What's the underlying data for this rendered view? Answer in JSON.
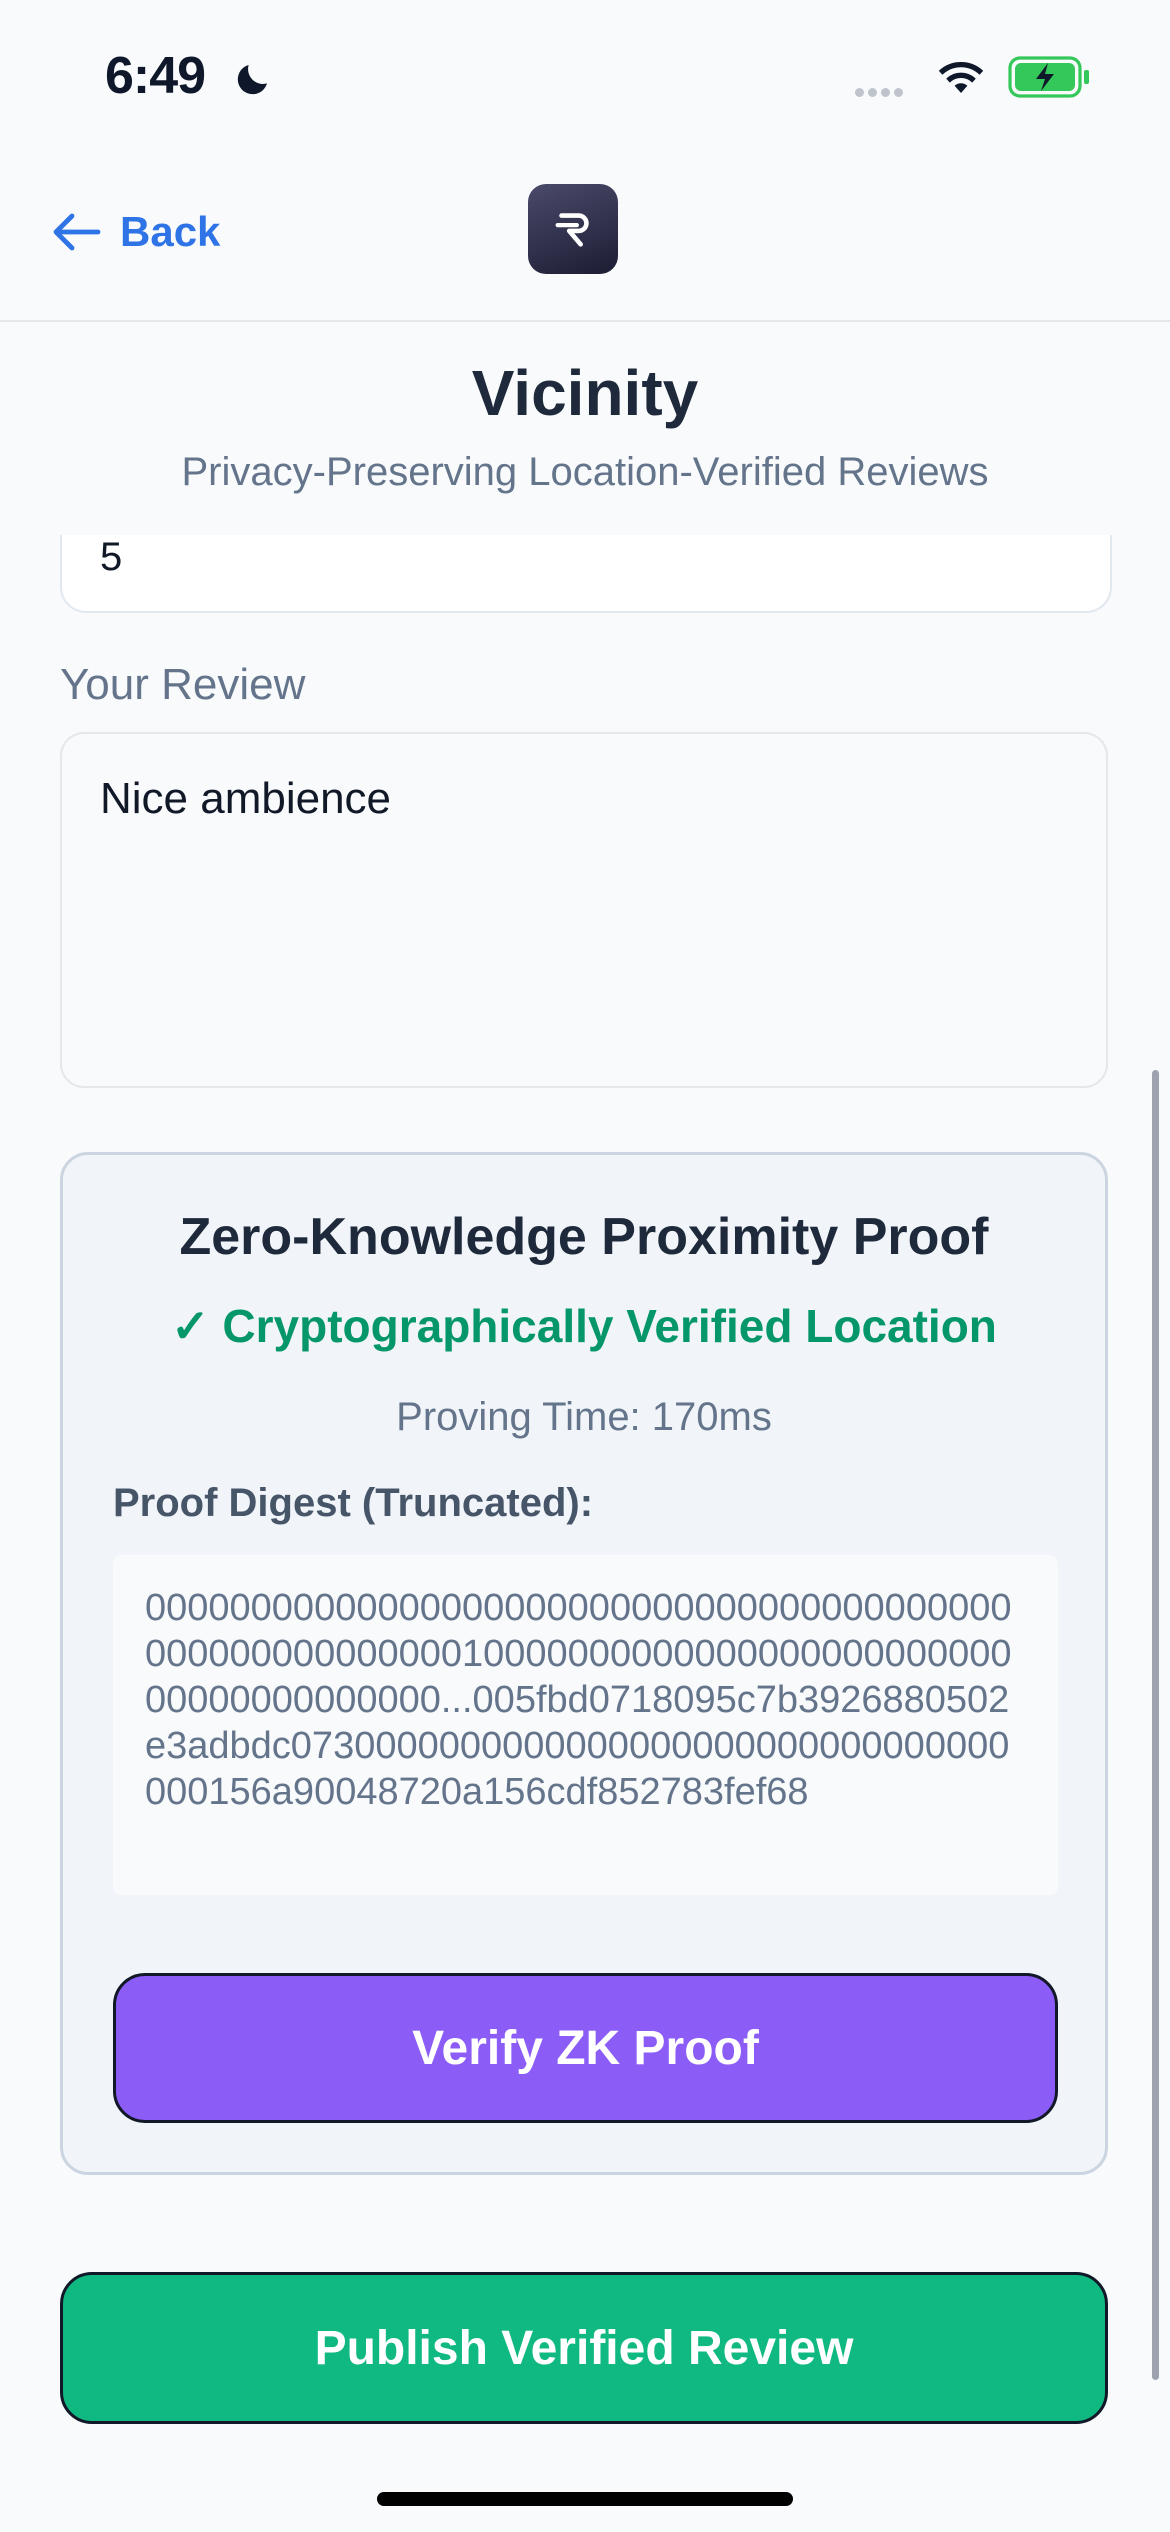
{
  "status_bar": {
    "time": "6:49",
    "icons": [
      "moon-icon",
      "signal-icon",
      "wifi-icon",
      "battery-charging-icon"
    ],
    "battery_color": "#34c759"
  },
  "nav": {
    "back_label": "Back",
    "back_icon": "arrow-left-icon",
    "logo_icon": "app-logo-icon",
    "accent_color": "#2f74e6"
  },
  "header": {
    "title": "Vicinity",
    "subtitle": "Privacy-Preserving Location-Verified Reviews"
  },
  "form": {
    "rating_value": "5",
    "review_label": "Your Review",
    "review_value": "Nice ambience"
  },
  "proof": {
    "title": "Zero-Knowledge Proximity Proof",
    "status": "✓ Cryptographically Verified Location",
    "status_color": "#059669",
    "proving_time": "Proving Time: 170ms",
    "digest_label": "Proof Digest (Truncated):",
    "digest_value": "000000000000000000000000000000000000000000000000000000001000000000000000000000000000000000000000...005fbd0718095c7b3926880502e3adbdc0730000000000000000000000000000000000156a90048720a156cdf852783fef68",
    "verify_label": "Verify ZK Proof",
    "verify_color": "#8b5cf6"
  },
  "actions": {
    "publish_label": "Publish Verified Review",
    "publish_color": "#10b981"
  }
}
